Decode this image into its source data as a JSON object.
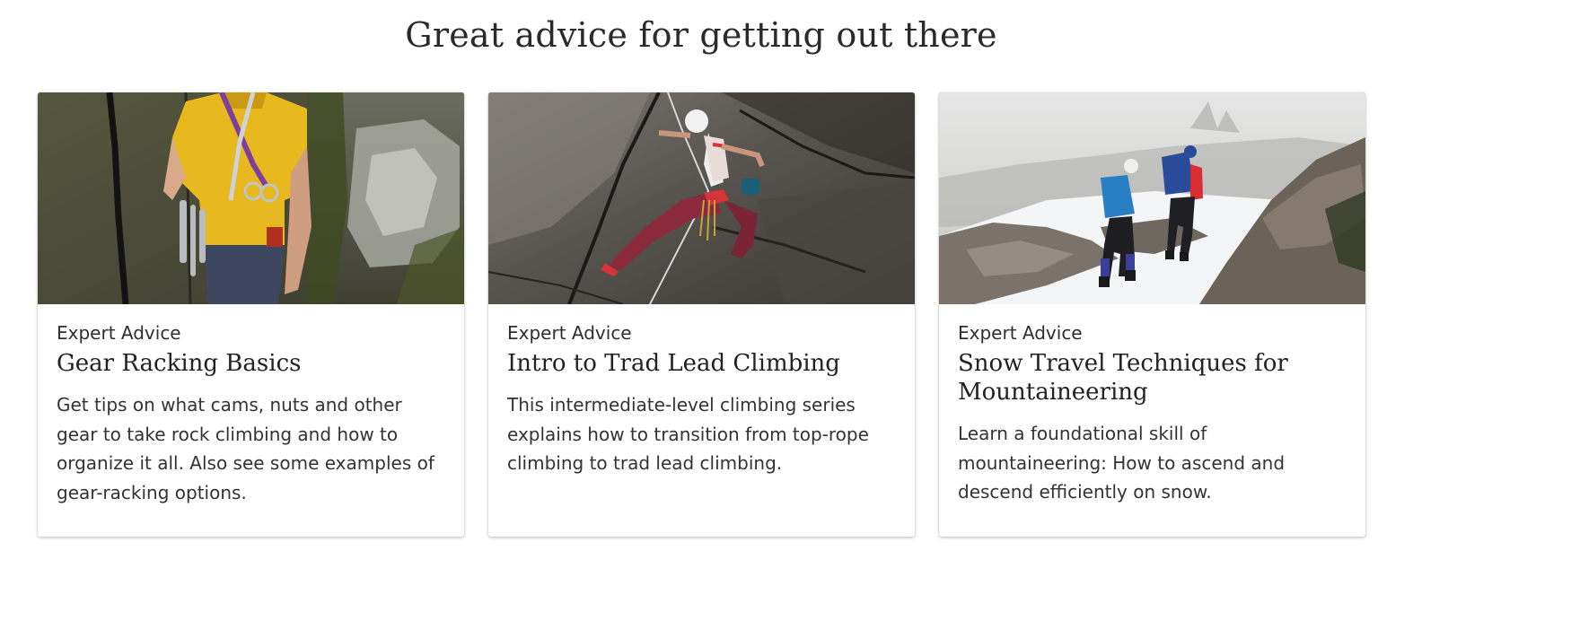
{
  "section": {
    "title": "Great advice for getting out there"
  },
  "cards": [
    {
      "category": "Expert Advice",
      "title": "Gear Racking Basics",
      "description": "Get tips on what cams, nuts and other gear to take rock climbing and how to organize it all. Also see some examples of gear-racking options.",
      "image": "climber-with-gear-rack-photo"
    },
    {
      "category": "Expert Advice",
      "title": "Intro to Trad Lead Climbing",
      "description": "This intermediate-level climbing series explains how to transition from top-rope climbing to trad lead climbing.",
      "image": "woman-lead-climbing-photo"
    },
    {
      "category": "Expert Advice",
      "title": "Snow Travel Techniques for Mountaineering",
      "description": "Learn a foundational skill of mountaineering: How to ascend and descend efficiently on snow.",
      "image": "hikers-on-snow-photo"
    }
  ]
}
